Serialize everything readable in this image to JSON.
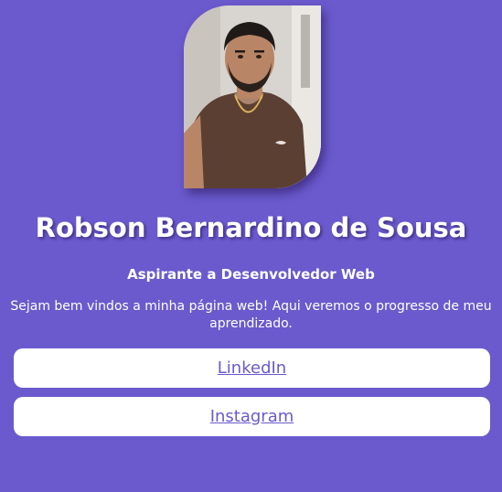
{
  "profile": {
    "name": "Robson Bernardino de Sousa",
    "role": "Aspirante a Desenvolvedor Web",
    "welcome": "Sejam bem vindos a minha página web! Aqui veremos o progresso de meu aprendizado."
  },
  "links": [
    {
      "label": "LinkedIn"
    },
    {
      "label": "Instagram"
    }
  ],
  "colors": {
    "background": "#6a5acd",
    "text": "#ffffff",
    "card": "#ffffff",
    "link": "#6a5acd"
  }
}
